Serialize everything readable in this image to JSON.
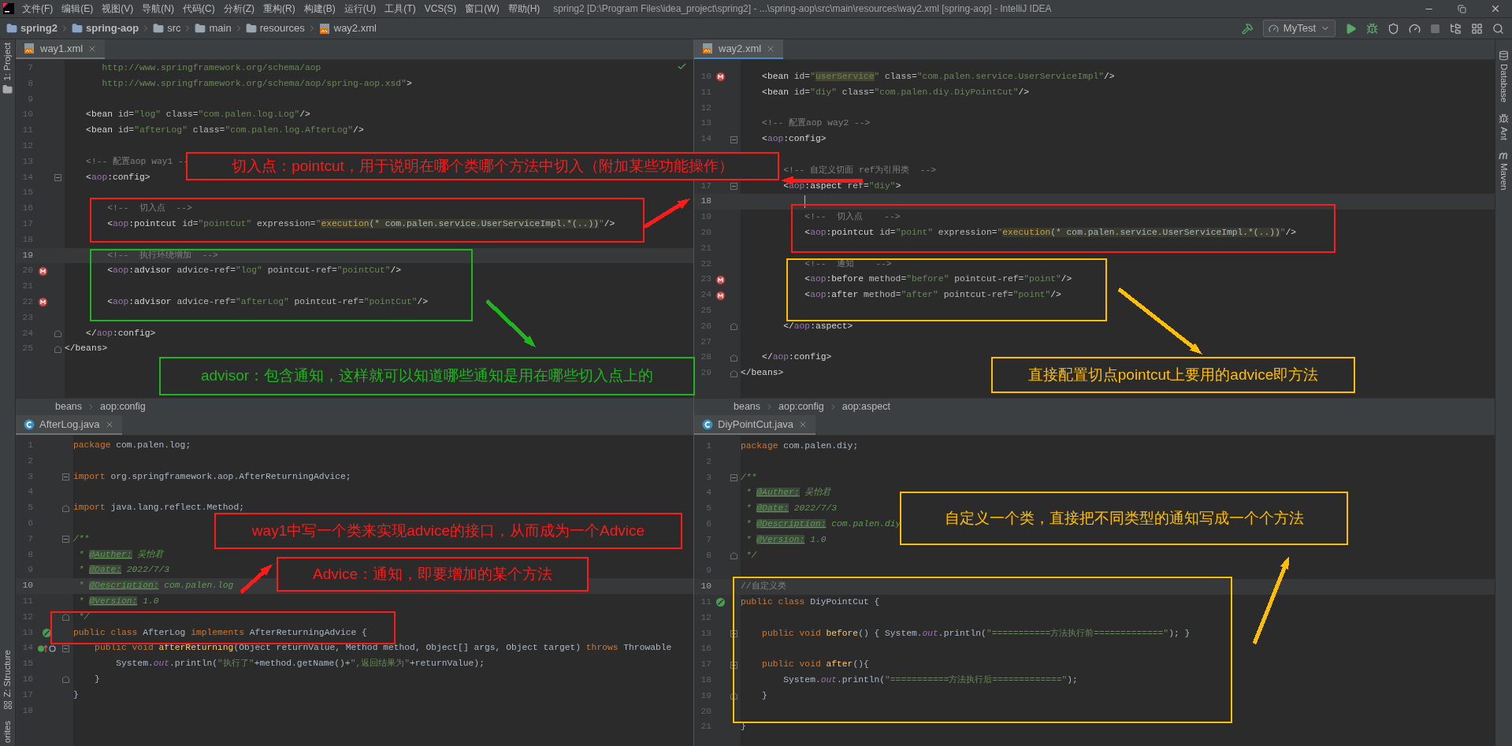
{
  "title_bar": {
    "menus": [
      "文件(F)",
      "编辑(E)",
      "视图(V)",
      "导航(N)",
      "代码(C)",
      "分析(Z)",
      "重构(R)",
      "构建(B)",
      "运行(U)",
      "工具(T)",
      "VCS(S)",
      "窗口(W)",
      "帮助(H)"
    ],
    "title": "spring2 [D:\\Program Files\\idea_project\\spring2] - ...\\spring-aop\\src\\main\\resources\\way2.xml [spring-aop] - IntelliJ IDEA"
  },
  "nav_bar": {
    "breadcrumbs": [
      {
        "label": "spring2",
        "kind": "project"
      },
      {
        "label": "spring-aop",
        "kind": "module"
      },
      {
        "label": "src",
        "kind": "folder"
      },
      {
        "label": "main",
        "kind": "folder"
      },
      {
        "label": "resources",
        "kind": "folder"
      },
      {
        "label": "way2.xml",
        "kind": "xml"
      }
    ],
    "run_config": "MyTest"
  },
  "left_tool_strip": [
    {
      "label": "1: Project",
      "kind": "project"
    },
    {
      "label": "Z: Structure",
      "kind": "structure"
    },
    {
      "label": "orites",
      "kind": "plain"
    }
  ],
  "right_tool_strip": [
    {
      "label": "Database",
      "kind": "database"
    },
    {
      "label": "Ant",
      "kind": "ant"
    },
    {
      "label": "Maven",
      "kind": "maven"
    }
  ],
  "editors": [
    {
      "tab": {
        "label": "way1.xml",
        "kind": "xml",
        "closable": true
      },
      "focused": false,
      "breadcrumbs": [
        "beans",
        "aop:config"
      ],
      "lines": [
        {
          "number": "7",
          "current": false,
          "tokens": [
            {
              "kind": "value",
              "text": "       http://www.springframework.org/schema/aop"
            }
          ]
        },
        {
          "number": "8",
          "current": false,
          "tokens": [
            {
              "kind": "value",
              "text": "       http://www.springframework.org/schema/aop/spring-aop.xsd\""
            },
            {
              "kind": "tag",
              "text": ">"
            }
          ]
        },
        {
          "number": "9",
          "current": false
        },
        {
          "number": "10",
          "current": false,
          "tokens": [
            {
              "kind": "tag",
              "text": "    <bean "
            },
            {
              "kind": "attr",
              "text": "id="
            },
            {
              "kind": "value",
              "text": "\"log\""
            },
            {
              "kind": "attr",
              "text": " class="
            },
            {
              "kind": "value",
              "text": "\"com.palen.log.Log\""
            },
            {
              "kind": "tag",
              "text": "/>"
            }
          ]
        },
        {
          "number": "11",
          "current": false,
          "tokens": [
            {
              "kind": "tag",
              "text": "    <bean "
            },
            {
              "kind": "attr",
              "text": "id="
            },
            {
              "kind": "value",
              "text": "\"afterLog\""
            },
            {
              "kind": "attr",
              "text": " class="
            },
            {
              "kind": "value",
              "text": "\"com.palen.log.AfterLog\""
            },
            {
              "kind": "tag",
              "text": "/>"
            }
          ]
        },
        {
          "number": "12",
          "current": false
        },
        {
          "number": "13",
          "current": false,
          "tokens": [
            {
              "kind": "comment",
              "text": "    <!-- 配置aop way1 --"
            }
          ]
        },
        {
          "number": "14",
          "current": false,
          "fold": {
            "kind": "start"
          },
          "tokens": [
            {
              "kind": "tag",
              "text": "    <"
            },
            {
              "kind": "ns",
              "text": "aop"
            },
            {
              "kind": "tag",
              "text": ":config>"
            }
          ]
        },
        {
          "number": "15",
          "current": false
        },
        {
          "number": "16",
          "current": false,
          "tokens": [
            {
              "kind": "comment",
              "text": "        <!--  切入点  -->"
            }
          ]
        },
        {
          "number": "17",
          "current": false,
          "tokens": [
            {
              "kind": "tag",
              "text": "        <"
            },
            {
              "kind": "ns",
              "text": "aop"
            },
            {
              "kind": "tag",
              "text": ":pointcut "
            },
            {
              "kind": "attr",
              "text": "id="
            },
            {
              "kind": "value",
              "text": "\"pointCut\""
            },
            {
              "kind": "attr",
              "text": " expression="
            },
            {
              "kind": "value",
              "text": "\""
            },
            {
              "kind": "exec",
              "text": "execution"
            },
            {
              "kind": "expr",
              "text": "(* com.palen.service.UserServiceImpl.*(..))"
            },
            {
              "kind": "value",
              "text": "\""
            },
            {
              "kind": "tag",
              "text": "/>"
            }
          ]
        },
        {
          "number": "18",
          "current": false
        },
        {
          "number": "19",
          "current": true,
          "tokens": [
            {
              "kind": "comment",
              "text": "        <!--  执行环绕增加  -->"
            }
          ]
        },
        {
          "number": "20",
          "current": false,
          "gutter": {
            "kind": "bean"
          },
          "tokens": [
            {
              "kind": "tag",
              "text": "        <"
            },
            {
              "kind": "ns",
              "text": "aop"
            },
            {
              "kind": "tag",
              "text": ":advisor "
            },
            {
              "kind": "attr",
              "text": "advice-ref="
            },
            {
              "kind": "value",
              "text": "\"log\""
            },
            {
              "kind": "attr",
              "text": " pointcut-ref="
            },
            {
              "kind": "value",
              "text": "\"pointCut\""
            },
            {
              "kind": "tag",
              "text": "/>"
            }
          ]
        },
        {
          "number": "21",
          "current": false
        },
        {
          "number": "22",
          "current": false,
          "gutter": {
            "kind": "bean"
          },
          "tokens": [
            {
              "kind": "tag",
              "text": "        <"
            },
            {
              "kind": "ns",
              "text": "aop"
            },
            {
              "kind": "tag",
              "text": ":advisor "
            },
            {
              "kind": "attr",
              "text": "advice-ref="
            },
            {
              "kind": "value",
              "text": "\"afterLog\""
            },
            {
              "kind": "attr",
              "text": " pointcut-ref="
            },
            {
              "kind": "value",
              "text": "\"pointCut\""
            },
            {
              "kind": "tag",
              "text": "/>"
            }
          ]
        },
        {
          "number": "23",
          "current": false
        },
        {
          "number": "24",
          "current": false,
          "fold": {
            "kind": "end"
          },
          "tokens": [
            {
              "kind": "tag",
              "text": "    </"
            },
            {
              "kind": "ns",
              "text": "aop"
            },
            {
              "kind": "tag",
              "text": ":config>"
            }
          ]
        },
        {
          "number": "25",
          "current": false,
          "fold": {
            "kind": "end"
          },
          "tokens": [
            {
              "kind": "tag",
              "text": "</beans>"
            }
          ]
        }
      ]
    },
    {
      "tab": {
        "label": "way2.xml",
        "kind": "xml",
        "closable": true
      },
      "focused": true,
      "breadcrumbs": [
        "beans",
        "aop:config",
        "aop:aspect"
      ],
      "lines": [
        {
          "number": "10",
          "current": false,
          "gutter": {
            "kind": "bean"
          },
          "tokens": [
            {
              "kind": "tag",
              "text": "    <bean "
            },
            {
              "kind": "attr",
              "text": "id="
            },
            {
              "kind": "value",
              "text": "\""
            },
            {
              "kind": "match",
              "text": "userService"
            },
            {
              "kind": "value",
              "text": "\""
            },
            {
              "kind": "attr",
              "text": " class="
            },
            {
              "kind": "value",
              "text": "\"com.palen.service.UserServiceImpl\""
            },
            {
              "kind": "tag",
              "text": "/>"
            }
          ]
        },
        {
          "number": "11",
          "current": false,
          "tokens": [
            {
              "kind": "tag",
              "text": "    <bean "
            },
            {
              "kind": "attr",
              "text": "id="
            },
            {
              "kind": "value",
              "text": "\"diy\""
            },
            {
              "kind": "attr",
              "text": " class="
            },
            {
              "kind": "value",
              "text": "\"com.palen.diy.DiyPointCut\""
            },
            {
              "kind": "tag",
              "text": "/>"
            }
          ]
        },
        {
          "number": "12",
          "current": false
        },
        {
          "number": "13",
          "current": false,
          "tokens": [
            {
              "kind": "comment",
              "text": "    <!-- 配置aop way2 -->"
            }
          ]
        },
        {
          "number": "14",
          "current": false,
          "fold": {
            "kind": "start"
          },
          "tokens": [
            {
              "kind": "tag",
              "text": "    <"
            },
            {
              "kind": "ns",
              "text": "aop"
            },
            {
              "kind": "tag",
              "text": ":config>"
            }
          ]
        },
        {
          "current": false
        },
        {
          "current": false,
          "tokens": [
            {
              "kind": "comment",
              "text": "        <!-- 自定义切面 ref为引用类  -->"
            }
          ]
        },
        {
          "number": "17",
          "current": false,
          "fold": {
            "kind": "start"
          },
          "tokens": [
            {
              "kind": "tag",
              "text": "        <"
            },
            {
              "kind": "ns",
              "text": "aop"
            },
            {
              "kind": "tag",
              "text": ":aspect "
            },
            {
              "kind": "attr",
              "text": "ref="
            },
            {
              "kind": "value",
              "text": "\"diy\""
            },
            {
              "kind": "tag",
              "text": ">"
            }
          ]
        },
        {
          "number": "18",
          "current": true
        },
        {
          "number": "19",
          "current": false,
          "tokens": [
            {
              "kind": "comment",
              "text": "            <!--  切入点    -->"
            }
          ]
        },
        {
          "number": "20",
          "current": false,
          "tokens": [
            {
              "kind": "tag",
              "text": "            <"
            },
            {
              "kind": "ns",
              "text": "aop"
            },
            {
              "kind": "tag",
              "text": ":pointcut "
            },
            {
              "kind": "attr",
              "text": "id="
            },
            {
              "kind": "value",
              "text": "\"point\""
            },
            {
              "kind": "attr",
              "text": " expression="
            },
            {
              "kind": "value",
              "text": "\""
            },
            {
              "kind": "exec",
              "text": "execution"
            },
            {
              "kind": "expr",
              "text": "(* com.palen.service.UserServiceImpl.*(..))"
            },
            {
              "kind": "value",
              "text": "\""
            },
            {
              "kind": "tag",
              "text": "/>"
            }
          ]
        },
        {
          "number": "21",
          "current": false
        },
        {
          "number": "22",
          "current": false,
          "tokens": [
            {
              "kind": "comment",
              "text": "            <!--  通知    -->"
            }
          ]
        },
        {
          "number": "23",
          "current": false,
          "gutter": {
            "kind": "bean"
          },
          "tokens": [
            {
              "kind": "tag",
              "text": "            <"
            },
            {
              "kind": "ns",
              "text": "aop"
            },
            {
              "kind": "tag",
              "text": ":before "
            },
            {
              "kind": "attr",
              "text": "method="
            },
            {
              "kind": "value",
              "text": "\"before\""
            },
            {
              "kind": "attr",
              "text": " pointcut-ref="
            },
            {
              "kind": "value",
              "text": "\"point\""
            },
            {
              "kind": "tag",
              "text": "/>"
            }
          ]
        },
        {
          "number": "24",
          "current": false,
          "gutter": {
            "kind": "bean"
          },
          "tokens": [
            {
              "kind": "tag",
              "text": "            <"
            },
            {
              "kind": "ns",
              "text": "aop"
            },
            {
              "kind": "tag",
              "text": ":after "
            },
            {
              "kind": "attr",
              "text": "method="
            },
            {
              "kind": "value",
              "text": "\"after\""
            },
            {
              "kind": "attr",
              "text": " pointcut-ref="
            },
            {
              "kind": "value",
              "text": "\"point\""
            },
            {
              "kind": "tag",
              "text": "/>"
            }
          ]
        },
        {
          "number": "25",
          "current": false
        },
        {
          "number": "26",
          "current": false,
          "fold": {
            "kind": "end"
          },
          "tokens": [
            {
              "kind": "tag",
              "text": "        </"
            },
            {
              "kind": "ns",
              "text": "aop"
            },
            {
              "kind": "tag",
              "text": ":aspect>"
            }
          ]
        },
        {
          "number": "27",
          "current": false
        },
        {
          "number": "28",
          "current": false,
          "fold": {
            "kind": "end"
          },
          "tokens": [
            {
              "kind": "tag",
              "text": "    </"
            },
            {
              "kind": "ns",
              "text": "aop"
            },
            {
              "kind": "tag",
              "text": ":config>"
            }
          ]
        },
        {
          "number": "29",
          "current": false,
          "fold": {
            "kind": "end"
          },
          "tokens": [
            {
              "kind": "tag",
              "text": "</beans>"
            }
          ]
        }
      ]
    },
    {
      "tab": {
        "label": "AfterLog.java",
        "kind": "class",
        "closable": true
      },
      "focused": false,
      "lines": [
        {
          "number": "1",
          "current": false,
          "tokens": [
            {
              "kind": "keyword",
              "text": "package"
            },
            {
              "kind": "plain",
              "text": " com.palen.log;"
            }
          ]
        },
        {
          "number": "2",
          "current": false
        },
        {
          "number": "3",
          "current": false,
          "fold": {
            "kind": "start"
          },
          "tokens": [
            {
              "kind": "keyword",
              "text": "import"
            },
            {
              "kind": "plain",
              "text": " org.springframework.aop.AfterReturningAdvice;"
            }
          ]
        },
        {
          "number": "4",
          "current": false
        },
        {
          "number": "5",
          "current": false,
          "fold": {
            "kind": "end"
          },
          "tokens": [
            {
              "kind": "keyword",
              "text": "import"
            },
            {
              "kind": "plain",
              "text": " java.lang.reflect.Method;"
            }
          ]
        },
        {
          "number": "6",
          "current": false
        },
        {
          "number": "7",
          "current": false,
          "fold": {
            "kind": "start"
          },
          "tokens": [
            {
              "kind": "doc",
              "text": "/**"
            }
          ]
        },
        {
          "number": "8",
          "current": false,
          "tokens": [
            {
              "kind": "doc",
              "text": " * "
            },
            {
              "kind": "doctag",
              "text": "@Auther:"
            },
            {
              "kind": "doc",
              "text": " 吴怡君"
            }
          ]
        },
        {
          "number": "9",
          "current": false,
          "tokens": [
            {
              "kind": "doc",
              "text": " * "
            },
            {
              "kind": "doctag",
              "text": "@Date:"
            },
            {
              "kind": "doc",
              "text": " 2022/7/3"
            }
          ]
        },
        {
          "number": "10",
          "current": true,
          "tokens": [
            {
              "kind": "doc",
              "text": " * "
            },
            {
              "kind": "doctag",
              "text": "@Description:"
            },
            {
              "kind": "doc",
              "text": " com.palen.log"
            }
          ]
        },
        {
          "number": "11",
          "current": false,
          "tokens": [
            {
              "kind": "doc",
              "text": " * "
            },
            {
              "kind": "doctag",
              "text": "@Version:"
            },
            {
              "kind": "doc",
              "text": " 1.0"
            }
          ]
        },
        {
          "number": "12",
          "current": false,
          "fold": {
            "kind": "end"
          },
          "tokens": [
            {
              "kind": "doc",
              "text": " */"
            }
          ]
        },
        {
          "number": "13",
          "current": false,
          "gutter": {
            "kind": "class"
          },
          "tokens": [
            {
              "kind": "keyword",
              "text": "public class "
            },
            {
              "kind": "plain",
              "text": "AfterLog "
            },
            {
              "kind": "keyword",
              "text": "implements "
            },
            {
              "kind": "plain",
              "text": "AfterReturningAdvice {"
            }
          ]
        },
        {
          "number": "14",
          "current": false,
          "gutter": {
            "kind": "override"
          },
          "fold": {
            "kind": "start"
          },
          "tokens": [
            {
              "kind": "keyword",
              "text": "    public void "
            },
            {
              "kind": "method",
              "text": "afterReturning"
            },
            {
              "kind": "plain",
              "text": "(Object returnValue, Method method, Object[] args, Object target) "
            },
            {
              "kind": "keyword",
              "text": "throws "
            },
            {
              "kind": "plain",
              "text": "Throwable"
            }
          ]
        },
        {
          "number": "15",
          "current": false,
          "tokens": [
            {
              "kind": "plain",
              "text": "        System."
            },
            {
              "kind": "field",
              "text": "out"
            },
            {
              "kind": "plain",
              "text": ".println("
            },
            {
              "kind": "string",
              "text": "\"执行了\""
            },
            {
              "kind": "plain",
              "text": "+method.getName()+"
            },
            {
              "kind": "string",
              "text": "\",返回结果为\""
            },
            {
              "kind": "plain",
              "text": "+returnValue);"
            }
          ]
        },
        {
          "number": "16",
          "current": false,
          "fold": {
            "kind": "end"
          },
          "tokens": [
            {
              "kind": "plain",
              "text": "    }"
            }
          ]
        },
        {
          "number": "17",
          "current": false,
          "tokens": [
            {
              "kind": "plain",
              "text": "}"
            }
          ]
        },
        {
          "number": "18",
          "current": false
        }
      ]
    },
    {
      "tab": {
        "label": "DiyPointCut.java",
        "kind": "class",
        "closable": true
      },
      "focused": false,
      "lines": [
        {
          "number": "1",
          "current": false,
          "tokens": [
            {
              "kind": "keyword",
              "text": "package"
            },
            {
              "kind": "plain",
              "text": " com.palen.diy;"
            }
          ]
        },
        {
          "number": "2",
          "current": false
        },
        {
          "number": "3",
          "current": false,
          "fold": {
            "kind": "start"
          },
          "tokens": [
            {
              "kind": "doc",
              "text": "/**"
            }
          ]
        },
        {
          "number": "4",
          "current": false,
          "tokens": [
            {
              "kind": "doc",
              "text": " * "
            },
            {
              "kind": "doctag",
              "text": "@Auther:"
            },
            {
              "kind": "doc",
              "text": " 吴怡君"
            }
          ]
        },
        {
          "number": "5",
          "current": false,
          "tokens": [
            {
              "kind": "doc",
              "text": " * "
            },
            {
              "kind": "doctag",
              "text": "@Date:"
            },
            {
              "kind": "doc",
              "text": " 2022/7/3"
            }
          ]
        },
        {
          "number": "6",
          "current": false,
          "tokens": [
            {
              "kind": "doc",
              "text": " * "
            },
            {
              "kind": "doctag",
              "text": "@Description:"
            },
            {
              "kind": "doc",
              "text": " com.palen.diy"
            }
          ]
        },
        {
          "number": "7",
          "current": false,
          "tokens": [
            {
              "kind": "doc",
              "text": " * "
            },
            {
              "kind": "doctag",
              "text": "@Version:"
            },
            {
              "kind": "doc",
              "text": " 1.0"
            }
          ]
        },
        {
          "number": "8",
          "current": false,
          "fold": {
            "kind": "end"
          },
          "tokens": [
            {
              "kind": "doc",
              "text": " */"
            }
          ]
        },
        {
          "number": "9",
          "current": false
        },
        {
          "number": "10",
          "current": true,
          "tokens": [
            {
              "kind": "comment",
              "text": "//自定义类"
            }
          ]
        },
        {
          "number": "11",
          "current": false,
          "gutter": {
            "kind": "class"
          },
          "tokens": [
            {
              "kind": "keyword",
              "text": "public class "
            },
            {
              "kind": "plain",
              "text": "DiyPointCut {"
            }
          ]
        },
        {
          "number": "12",
          "current": false
        },
        {
          "number": "13",
          "current": false,
          "fold": {
            "kind": "start"
          },
          "tokens": [
            {
              "kind": "keyword",
              "text": "    public void "
            },
            {
              "kind": "method",
              "text": "before"
            },
            {
              "kind": "plain",
              "text": "() { System."
            },
            {
              "kind": "field",
              "text": "out"
            },
            {
              "kind": "plain",
              "text": ".println("
            },
            {
              "kind": "string",
              "text": "\"===========方法执行前=============\""
            },
            {
              "kind": "plain",
              "text": "); }"
            }
          ]
        },
        {
          "number": "16",
          "current": false
        },
        {
          "number": "17",
          "current": false,
          "fold": {
            "kind": "start"
          },
          "tokens": [
            {
              "kind": "keyword",
              "text": "    public void "
            },
            {
              "kind": "method",
              "text": "after"
            },
            {
              "kind": "plain",
              "text": "(){"
            }
          ]
        },
        {
          "number": "18",
          "current": false,
          "tokens": [
            {
              "kind": "plain",
              "text": "        System."
            },
            {
              "kind": "field",
              "text": "out"
            },
            {
              "kind": "plain",
              "text": ".println("
            },
            {
              "kind": "string",
              "text": "\"===========方法执行后=============\""
            },
            {
              "kind": "plain",
              "text": ");"
            }
          ]
        },
        {
          "number": "19",
          "current": false,
          "fold": {
            "kind": "end"
          },
          "tokens": [
            {
              "kind": "plain",
              "text": "    }"
            }
          ]
        },
        {
          "number": "20",
          "current": false
        },
        {
          "number": "21",
          "current": false,
          "tokens": [
            {
              "kind": "plain",
              "text": "}"
            }
          ]
        }
      ]
    }
  ],
  "annotations": [
    {
      "kind": "callout",
      "color": "#ff1a1a",
      "text": "切入点：pointcut，用于说明在哪个类哪个方法中切入（附加某些功能操作）"
    },
    {
      "kind": "box",
      "color": "#ff1a1a"
    },
    {
      "kind": "arrow",
      "color": "#ff1a1a"
    },
    {
      "kind": "arrow",
      "color": "#ff1a1a"
    },
    {
      "kind": "box",
      "color": "#1fb51f"
    },
    {
      "kind": "arrow",
      "color": "#1fb51f"
    },
    {
      "kind": "callout",
      "color": "#1fb51f",
      "text": "advisor：包含通知，这样就可以知道哪些通知是用在哪些切入点上的"
    },
    {
      "kind": "box",
      "color": "#ff1a1a"
    },
    {
      "kind": "box",
      "color": "#ffbf00"
    },
    {
      "kind": "arrow",
      "color": "#ffbf00"
    },
    {
      "kind": "callout",
      "color": "#ffbf00",
      "text": "直接配置切点pointcut上要用的advice即方法"
    },
    {
      "kind": "callout",
      "color": "#ff1a1a",
      "text": "way1中写一个类来实现advice的接口，从而成为一个Advice"
    },
    {
      "kind": "callout",
      "color": "#ff1a1a",
      "text": "Advice：通知，即要增加的某个方法"
    },
    {
      "kind": "arrow",
      "color": "#ff1a1a"
    },
    {
      "kind": "box",
      "color": "#ff1a1a"
    },
    {
      "kind": "callout",
      "color": "#ffbf00",
      "text": "自定义一个类，直接把不同类型的通知写成一个个方法"
    },
    {
      "kind": "box",
      "color": "#ffbf00"
    },
    {
      "kind": "arrow",
      "color": "#ffbf00"
    }
  ]
}
